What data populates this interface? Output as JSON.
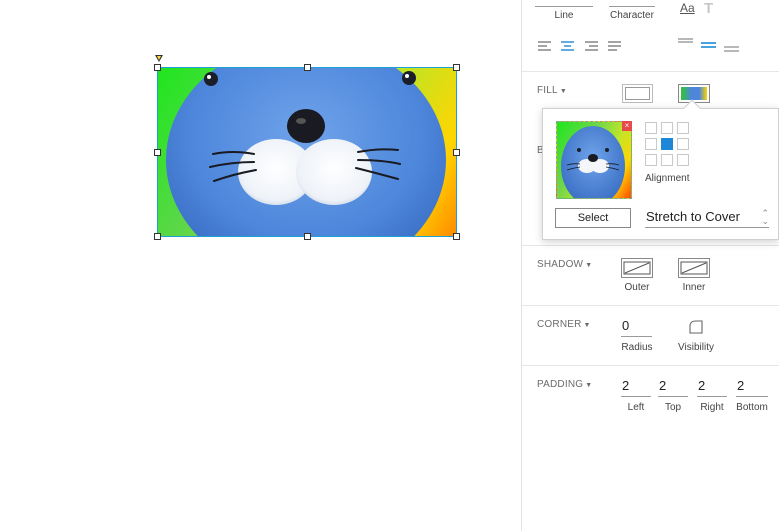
{
  "canvas": {
    "image_alt": "blue seal face image"
  },
  "tabs": [
    {
      "label": "Line"
    },
    {
      "label": "Character"
    }
  ],
  "text_icons": {
    "aa_glyph": "Aa",
    "t_glyph": "T"
  },
  "sections": {
    "fill": {
      "label": "FILL"
    },
    "border_partial": {
      "label": "B"
    },
    "shadow": {
      "label": "SHADOW",
      "outer": "Outer",
      "inner": "Inner"
    },
    "corner": {
      "label": "CORNER",
      "radius_value": "0",
      "radius_caption": "Radius",
      "visibility_caption": "Visibility"
    },
    "padding": {
      "label": "PADDING",
      "fields": [
        {
          "value": "2",
          "caption": "Left"
        },
        {
          "value": "2",
          "caption": "Top"
        },
        {
          "value": "2",
          "caption": "Right"
        },
        {
          "value": "2",
          "caption": "Bottom"
        }
      ]
    }
  },
  "fill_popup": {
    "alignment_label": "Alignment",
    "select_label": "Select",
    "mode_value": "Stretch to Cover",
    "active_alignment": "center",
    "close_glyph": "×"
  },
  "colors": {
    "accent": "#1e88d6",
    "selection": "#1ea0d6",
    "section_label": "#6b6b6b"
  }
}
